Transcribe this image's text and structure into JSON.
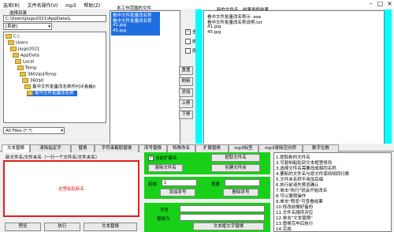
{
  "menu": {
    "items": [
      "选项(R)",
      "文件名操作(V)",
      "mp3",
      "帮助(Z)"
    ]
  },
  "left_panel": {
    "label": "选择目录",
    "path_value": "C:\\Users\\jiugo2021\\AppData\\L",
    "drive_value": "[系统]",
    "tree_nodes": [
      "C:\\",
      "Users",
      "jiugo2021",
      "AppData",
      "Local",
      "Temp",
      "360zip$Temp",
      "360$0",
      "看中文件批量改名称件PDF表格0",
      "看中文件批量改名称"
    ],
    "filter_value": "All Files (*.*)"
  },
  "file_list": {
    "label": "本工作范围的文件",
    "items": [
      "看中文件批量改名称",
      "看中文件批量改名称",
      "41.jpg",
      "45.jpg"
    ]
  },
  "options": {
    "items": [
      "全选",
      "前段",
      "原始"
    ]
  },
  "mid_buttons": [
    "重置",
    "刷新",
    "添加",
    "上移",
    "下移"
  ],
  "right_panel": {
    "label": "新的文件名，结果最终结果",
    "items": [
      "看中文件批量改名称示 .exe",
      "看中文件批量改名称说明.txt",
      "41.jpg",
      "45.jpg"
    ]
  },
  "tabs": [
    "文本替换",
    "清除指定字",
    "替换",
    "字符串截取替换",
    "序号替换",
    "特殊命名",
    "扩展替换",
    "mp3标签",
    "mp3清除空白项",
    "数字位数"
  ],
  "bottom_left": {
    "label": "新文件名/文件夹名（一行一个文件名/文件夹名）",
    "placeholder": "这里粘贴新名",
    "buttons": [
      "预览",
      "执行",
      "文本替换"
    ]
  },
  "green_panel": {
    "check1": "当前扩展名",
    "button1": "提取文件名",
    "button2": "清除文件名",
    "button3": "创建文件夹",
    "field1_label": "起始",
    "field1_value": "1",
    "field2_label": "增量",
    "button4": "添加序号",
    "button5": "删除序号",
    "field3_label": "字符",
    "field4_label": "替换为",
    "button6": "文本框文字替换"
  },
  "bottom_right": {
    "lines": [
      "1.提取新的文件名",
      "2.可复制粘贴到文本框里修改",
      "3.选择文件名需要改成相同名称",
      "4.要新的文件名与原文件保持相同行数",
      "5.文件夹名称不用加后缀",
      "6.执行前请先预览确认",
      "7.单击\"执行\"就会开始改名",
      "8.可以撤销操作",
      "9.单击\"预览\"可查看结果",
      "10.修改前做好备份",
      "11.文件名顺序对应",
      "12.单击\"文本替换\"",
      "13.替换完毕后执行",
      "14.完成"
    ]
  },
  "colors": {
    "selection": "#1e6ee0",
    "cyan": "#00ffff",
    "green": "#19d019",
    "red_border": "#e02020"
  }
}
